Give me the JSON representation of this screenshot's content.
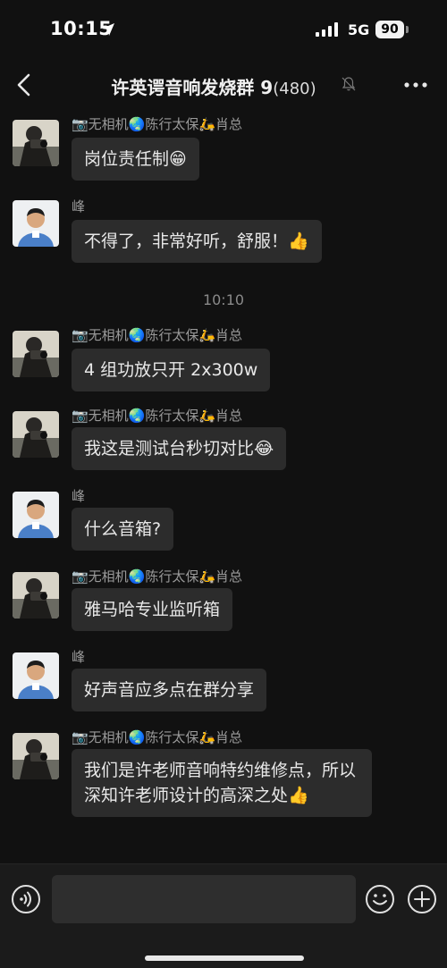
{
  "status": {
    "time": "10:15",
    "network": "5G",
    "battery": "90"
  },
  "nav": {
    "title": "许英谔音响发烧群 9",
    "count": "(480)"
  },
  "messages": [
    {
      "sender": "📷无相机🌏陈行太保🛵肖总",
      "text": "岗位责任制😁",
      "avatar": "photographer"
    },
    {
      "sender": "峰",
      "text": "不得了，非常好听，舒服！👍",
      "avatar": "man"
    },
    {
      "sender": "📷无相机🌏陈行太保🛵肖总",
      "text": "4 组功放只开 2x300w",
      "avatar": "photographer"
    },
    {
      "sender": "📷无相机🌏陈行太保🛵肖总",
      "text": "我这是测试台秒切对比😂",
      "avatar": "photographer"
    },
    {
      "sender": "峰",
      "text": "什么音箱?",
      "avatar": "man"
    },
    {
      "sender": "📷无相机🌏陈行太保🛵肖总",
      "text": "雅马哈专业监听箱",
      "avatar": "photographer"
    },
    {
      "sender": "峰",
      "text": "好声音应多点在群分享",
      "avatar": "man"
    },
    {
      "sender": "📷无相机🌏陈行太保🛵肖总",
      "text": "我们是许老师音响特约维修点，所以深知许老师设计的高深之处👍",
      "avatar": "photographer"
    }
  ],
  "timestamp": "10:10",
  "icons": {
    "back": "chevron-left-icon",
    "more": "more-dots-icon",
    "mute": "bell-off-icon",
    "voice": "voice-icon",
    "emoji": "smiley-icon",
    "plus": "plus-icon"
  },
  "colors": {
    "background": "#111111",
    "bubble": "#2c2c2c",
    "sender": "#9a9a9a"
  }
}
